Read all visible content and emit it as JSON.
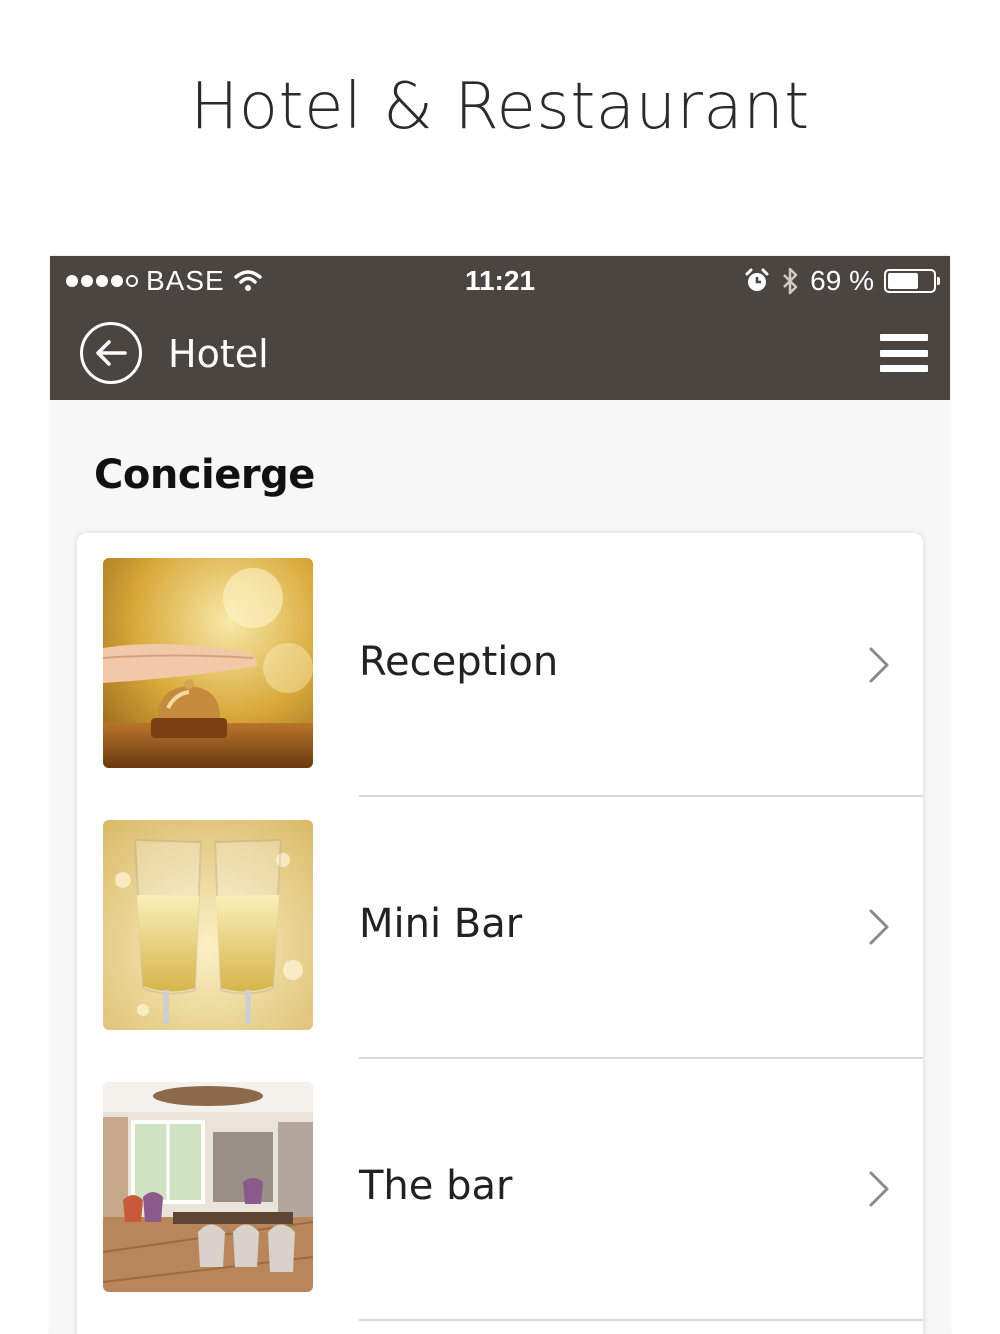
{
  "promo": {
    "title": "Hotel & Restaurant"
  },
  "status_bar": {
    "carrier": "BASE",
    "time": "11:21",
    "battery_percent": "69 %",
    "battery_level": 0.69
  },
  "nav": {
    "title": "Hotel",
    "back_icon": "back-arrow-circle-icon",
    "menu_icon": "hamburger-menu-icon"
  },
  "section": {
    "heading": "Concierge"
  },
  "items": [
    {
      "label": "Reception",
      "image": "reception-bell-image"
    },
    {
      "label": "Mini Bar",
      "image": "champagne-glasses-image"
    },
    {
      "label": "The bar",
      "image": "bar-interior-image"
    }
  ],
  "colors": {
    "header_bg": "#4a4541",
    "text": "#222222",
    "divider": "#d8d8d8"
  }
}
